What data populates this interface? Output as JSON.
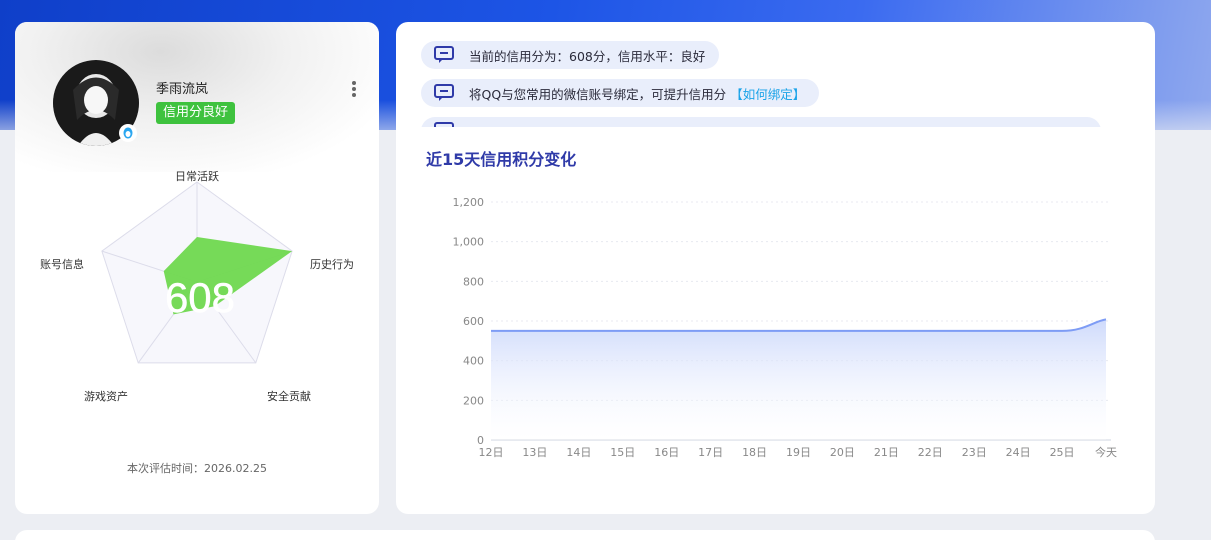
{
  "profile": {
    "username": "季雨流岚",
    "credit_badge": "信用分良好",
    "score": "608",
    "eval_time": "本次评估时间：2026.02.25",
    "radar_labels": {
      "top": "日常活跃",
      "right": "历史行为",
      "bottom_right": "安全贡献",
      "bottom_left": "游戏资产",
      "left": "账号信息"
    },
    "radar_values": [
      0.45,
      1.0,
      0.3,
      0.4,
      0.35
    ]
  },
  "tips": [
    {
      "text": "当前的信用分为：608分，信用水平：良好",
      "link": ""
    },
    {
      "text": "将QQ与您常用的微信账号绑定，可提升信用分",
      "link": "【如何绑定】"
    }
  ],
  "chart_title": "近15天信用积分变化",
  "colors": {
    "accent": "#2f3aa8",
    "badge_green": "#3ec23e",
    "line": "#7e9cf5",
    "radar_fill": "#6fd84f"
  },
  "chart_data": {
    "type": "area",
    "title": "近15天信用积分变化",
    "categories": [
      "12日",
      "13日",
      "14日",
      "15日",
      "16日",
      "17日",
      "18日",
      "19日",
      "20日",
      "21日",
      "22日",
      "23日",
      "24日",
      "25日",
      "今天"
    ],
    "series": [
      {
        "values": [
          550,
          550,
          550,
          550,
          550,
          550,
          550,
          550,
          550,
          550,
          550,
          550,
          550,
          550,
          608
        ]
      }
    ],
    "y_ticks": [
      "0",
      "200",
      "400",
      "600",
      "800",
      "1,000",
      "1,200"
    ],
    "ylim": [
      0,
      1200
    ],
    "grid": true
  }
}
